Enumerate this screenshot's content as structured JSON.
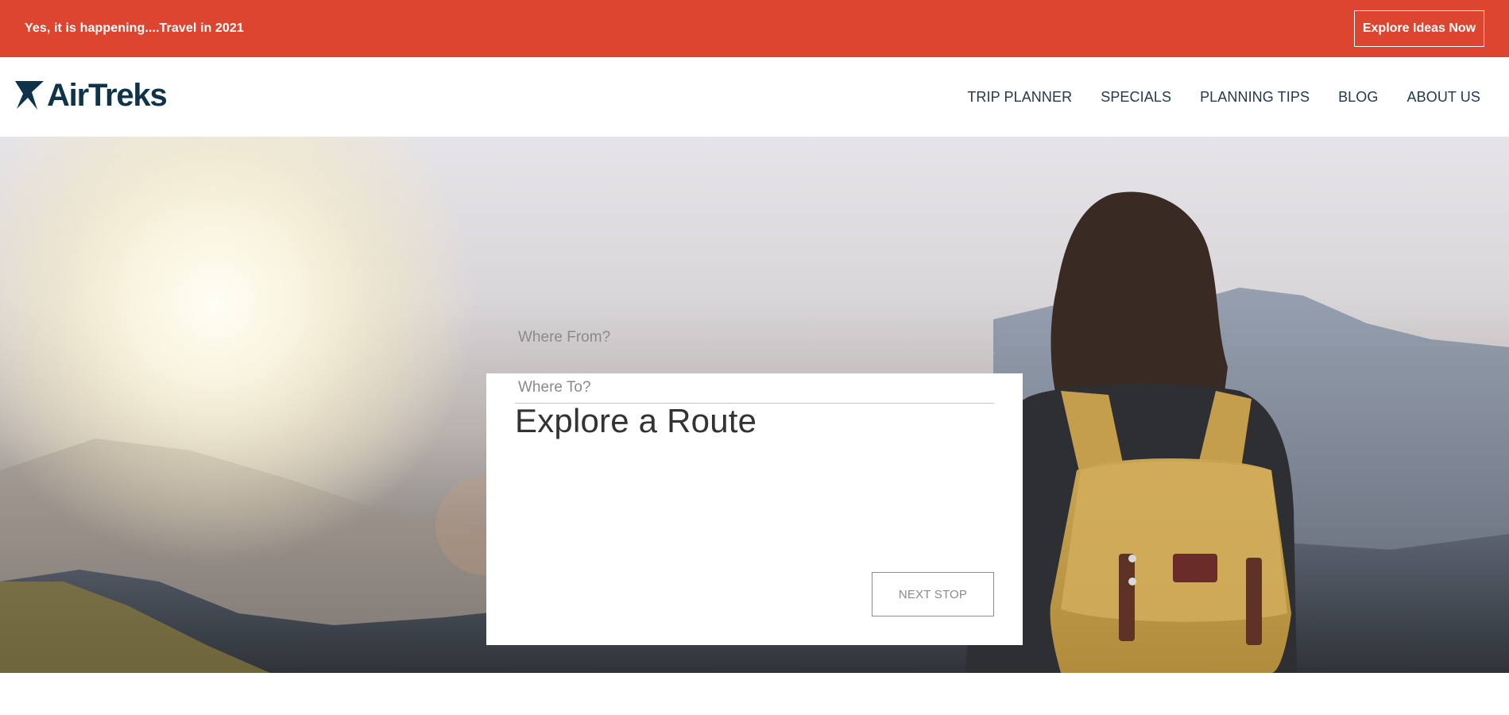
{
  "colors": {
    "promo_bg": "#dc4631",
    "brand_navy": "#0f3349",
    "nav_text": "#24394a"
  },
  "promo": {
    "text": "Yes, it is happening....Travel in 2021",
    "button_label": "Explore Ideas Now"
  },
  "header": {
    "logo_text": "AirTreks",
    "logo_icon": "airtreks-bird-icon",
    "nav": [
      {
        "label": "TRIP PLANNER"
      },
      {
        "label": "SPECIALS"
      },
      {
        "label": "PLANNING TIPS"
      },
      {
        "label": "BLOG"
      },
      {
        "label": "ABOUT US"
      }
    ]
  },
  "route_card": {
    "title": "Explore a Route",
    "from_placeholder": "Where From?",
    "to_placeholder": "Where To?",
    "button_label": "NEXT STOP"
  }
}
